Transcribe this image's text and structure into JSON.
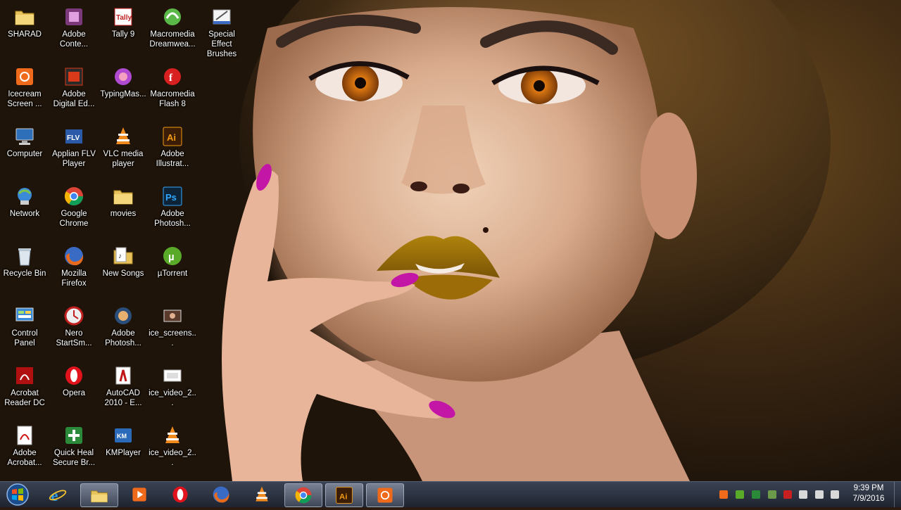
{
  "desktop": {
    "icons": [
      {
        "label": "SHARAD",
        "icon": "folder-icon"
      },
      {
        "label": "Adobe\nConte...",
        "icon": "adobe-content-icon"
      },
      {
        "label": "Tally 9",
        "icon": "tally-icon"
      },
      {
        "label": "Macromedia\nDreamwea...",
        "icon": "dreamweaver-icon"
      },
      {
        "label": "Special Effect\nBrushes",
        "icon": "brushes-icon"
      },
      {
        "label": "Icecream\nScreen ...",
        "icon": "icecream-icon"
      },
      {
        "label": "Adobe\nDigital Ed...",
        "icon": "adobe-digital-editions-icon"
      },
      {
        "label": "TypingMas...",
        "icon": "typingmaster-icon"
      },
      {
        "label": "Macromedia\nFlash 8",
        "icon": "flash-icon"
      },
      {
        "label": "Computer",
        "icon": "computer-icon"
      },
      {
        "label": "Applian FLV\nPlayer",
        "icon": "flv-player-icon"
      },
      {
        "label": "VLC media\nplayer",
        "icon": "vlc-icon"
      },
      {
        "label": "Adobe\nIllustrat...",
        "icon": "illustrator-icon"
      },
      {
        "label": "Network",
        "icon": "network-icon"
      },
      {
        "label": "Google\nChrome",
        "icon": "chrome-icon"
      },
      {
        "label": "movies",
        "icon": "folder-icon"
      },
      {
        "label": "Adobe\nPhotosh...",
        "icon": "photoshop-icon"
      },
      {
        "label": "Recycle Bin",
        "icon": "recycle-bin-icon"
      },
      {
        "label": "Mozilla\nFirefox",
        "icon": "firefox-icon"
      },
      {
        "label": "New Songs",
        "icon": "folder-music-icon"
      },
      {
        "label": "µTorrent",
        "icon": "utorrent-icon"
      },
      {
        "label": "Control\nPanel",
        "icon": "control-panel-icon"
      },
      {
        "label": "Nero\nStartSm...",
        "icon": "nero-icon"
      },
      {
        "label": "Adobe\nPhotosh...",
        "icon": "photoshop-old-icon"
      },
      {
        "label": "ice_screens...",
        "icon": "image-file-icon"
      },
      {
        "label": "Acrobat\nReader DC",
        "icon": "acrobat-reader-icon"
      },
      {
        "label": "Opera",
        "icon": "opera-icon"
      },
      {
        "label": "AutoCAD\n2010 - E...",
        "icon": "autocad-icon"
      },
      {
        "label": "ice_video_2...",
        "icon": "video-file-icon"
      },
      {
        "label": "Adobe\nAcrobat...",
        "icon": "acrobat-icon"
      },
      {
        "label": "Quick Heal\nSecure Br...",
        "icon": "quickheal-icon"
      },
      {
        "label": "KMPlayer",
        "icon": "kmplayer-icon"
      },
      {
        "label": "ice_video_2...",
        "icon": "vlc-file-icon"
      }
    ]
  },
  "taskbar": {
    "pinned": [
      {
        "icon": "internet-explorer-icon",
        "active": false
      },
      {
        "icon": "file-explorer-icon",
        "active": true
      },
      {
        "icon": "media-player-icon",
        "active": false
      },
      {
        "icon": "opera-icon",
        "active": false
      },
      {
        "icon": "firefox-icon",
        "active": false
      },
      {
        "icon": "vlc-icon",
        "active": false
      },
      {
        "icon": "chrome-icon",
        "active": true
      },
      {
        "icon": "illustrator-icon",
        "active": true,
        "text": "Ai"
      },
      {
        "icon": "icecream-recorder-icon",
        "active": true
      }
    ],
    "tray": [
      "icecream-tray-icon",
      "utorrent-tray-icon",
      "quickheal-tray-icon",
      "battery-icon",
      "flag-icon",
      "action-center-icon",
      "network-tray-icon",
      "volume-icon"
    ],
    "clock": {
      "time": "9:39 PM",
      "date": "7/9/2016"
    }
  },
  "colors": {
    "taskbar_bg": "#2a3040",
    "label_text": "#ffffff"
  }
}
